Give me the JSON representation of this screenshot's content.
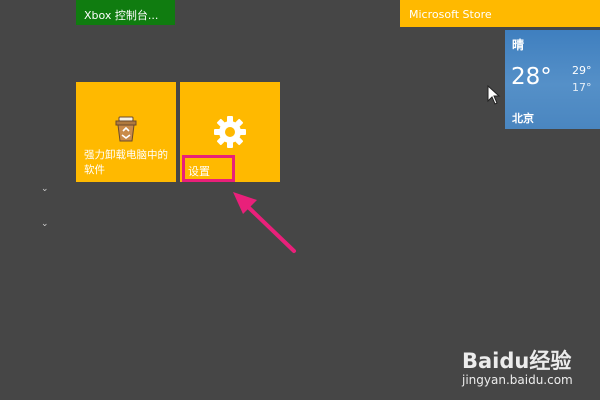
{
  "tiles": {
    "xbox": {
      "label": "Xbox 控制台..."
    },
    "store": {
      "label": "Microsoft Store"
    },
    "weather": {
      "condition": "晴",
      "temperature": "28°",
      "high": "29°",
      "low": "17°",
      "city": "北京"
    },
    "uninstall": {
      "label": "强力卸载电脑中的软件",
      "icon": "recycle-bin-icon"
    },
    "settings": {
      "label": "设置",
      "icon": "gear-icon"
    }
  },
  "annotation": {
    "color": "#e9207a"
  },
  "watermark": {
    "brand": "Baidu经验",
    "url": "jingyan.baidu.com"
  },
  "colors": {
    "background": "#464646",
    "tile_yellow": "#ffb900",
    "xbox_green": "#107c10",
    "weather_blue": "#4a86c0"
  }
}
